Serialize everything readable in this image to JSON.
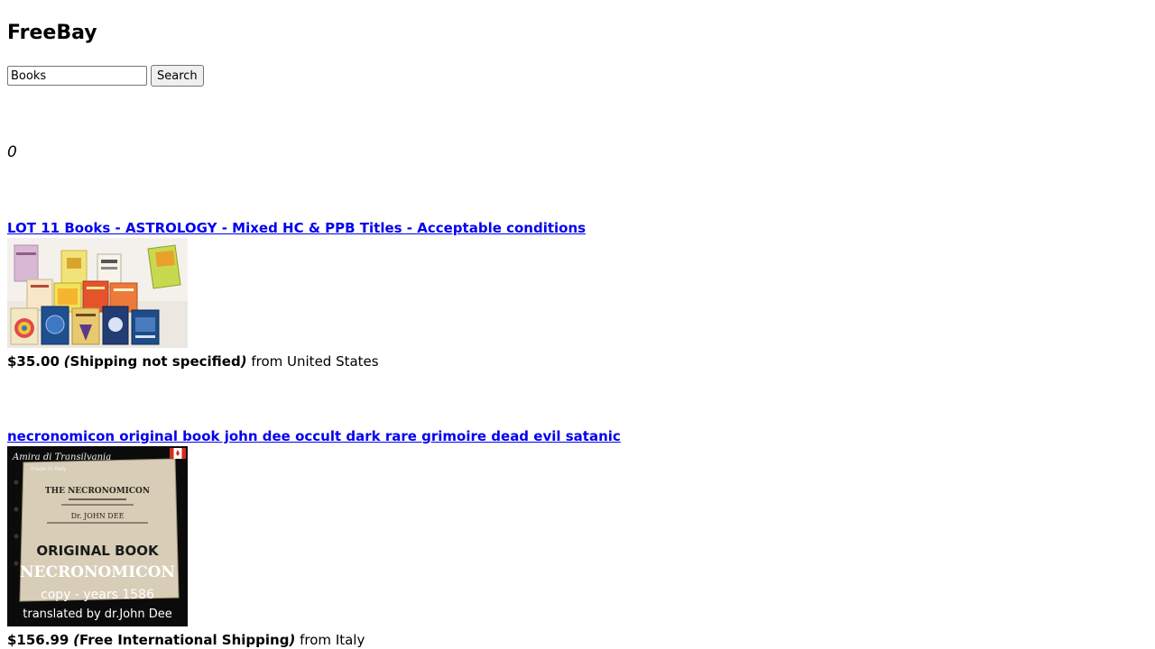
{
  "app": {
    "title": "FreeBay"
  },
  "search": {
    "value": "Books",
    "button_label": "Search"
  },
  "results": {
    "count": "0"
  },
  "listings": [
    {
      "title": "LOT 11 Books - ASTROLOGY - Mixed HC & PPB Titles - Acceptable conditions",
      "price": "$35.00",
      "shipping": "Shipping not specified",
      "from_label": "from",
      "location": "United States"
    },
    {
      "title": "necronomicon original book john dee occult dark rare grimoire dead evil satanic",
      "price": "$156.99",
      "shipping": "Free International Shipping",
      "from_label": "from",
      "location": "Italy",
      "image_text": {
        "brand": "Amira di Transilvania",
        "made_in": "made in Italy",
        "page_title": "THE NECRONOMICON",
        "page_author": "Dr. JOHN DEE",
        "line1": "ORIGINAL BOOK",
        "line2": "NECRONOMICON",
        "line3": "copy - years 1586",
        "line4": "translated by dr.John Dee"
      }
    }
  ],
  "colors": {
    "link": "#0000ee",
    "text": "#000000",
    "background": "#ffffff"
  }
}
